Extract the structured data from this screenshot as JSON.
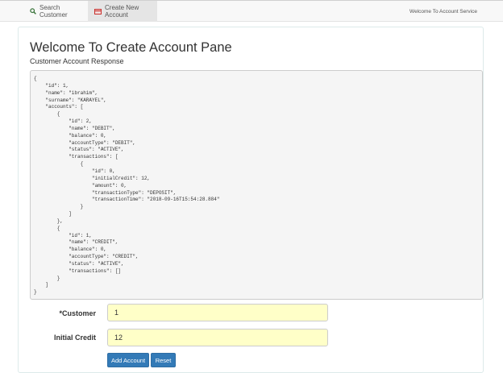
{
  "nav": {
    "tabs": [
      {
        "label": "Search Customer",
        "icon": "search-icon"
      },
      {
        "label": "Create New Account",
        "icon": "card-icon"
      }
    ],
    "right_text": "Welcome To Account Service"
  },
  "page": {
    "title": "Welcome To Create Account Pane",
    "subtitle": "Customer Account Response"
  },
  "response_json": "{\n    \"id\": 1,\n    \"name\": \"ibrahim\",\n    \"surname\": \"KARAYEL\",\n    \"accounts\": [\n        {\n            \"id\": 2,\n            \"name\": \"DEBIT\",\n            \"balance\": 0,\n            \"accountType\": \"DEBIT\",\n            \"status\": \"ACTIVE\",\n            \"transactions\": [\n                {\n                    \"id\": 0,\n                    \"initialCredit\": 12,\n                    \"amount\": 0,\n                    \"transactionType\": \"DEPOSIT\",\n                    \"transactionTime\": \"2018-09-16T15:54:28.884\"\n                }\n            ]\n        },\n        {\n            \"id\": 1,\n            \"name\": \"CREDIT\",\n            \"balance\": 0,\n            \"accountType\": \"CREDIT\",\n            \"status\": \"ACTIVE\",\n            \"transactions\": []\n        }\n    ]\n}",
  "form": {
    "customer_label": "*Customer",
    "customer_value": "1",
    "credit_label": "Initial Credit",
    "credit_value": "12",
    "add_label": "Add Account",
    "reset_label": "Reset"
  },
  "colors": {
    "primary": "#337ab7",
    "input_bg": "#ffffc8",
    "search_icon": "#3c763d",
    "card_icon": "#c9302c"
  }
}
